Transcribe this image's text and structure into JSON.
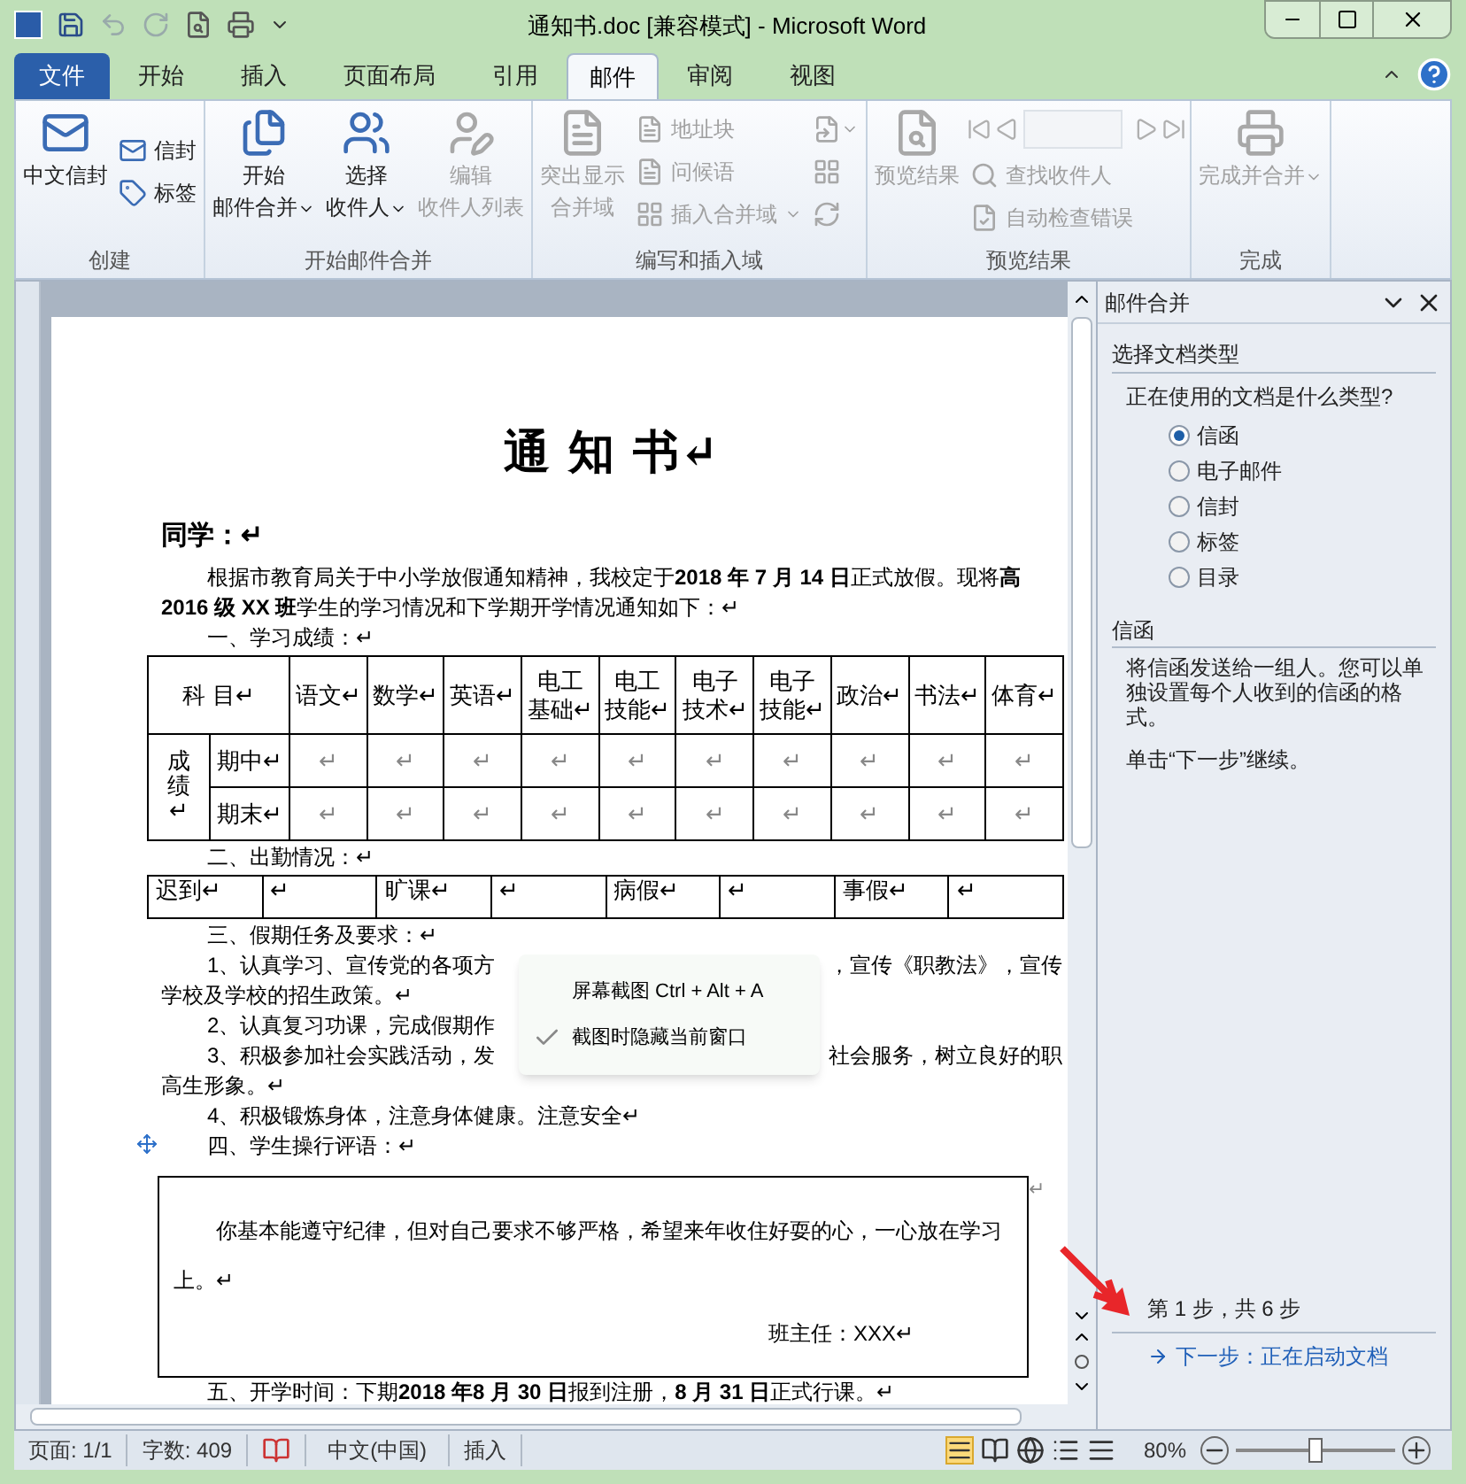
{
  "window": {
    "title": "通知书.doc [兼容模式] - Microsoft Word"
  },
  "tabs": [
    {
      "label": "文件",
      "kind": "file",
      "selected": false
    },
    {
      "label": "开始",
      "kind": "tab",
      "selected": false
    },
    {
      "label": "插入",
      "kind": "tab",
      "selected": false
    },
    {
      "label": "页面布局",
      "kind": "tab",
      "selected": false
    },
    {
      "label": "引用",
      "kind": "tab",
      "selected": false
    },
    {
      "label": "邮件",
      "kind": "tab",
      "selected": true
    },
    {
      "label": "审阅",
      "kind": "tab",
      "selected": false
    },
    {
      "label": "视图",
      "kind": "tab",
      "selected": false
    }
  ],
  "ribbon_groups": [
    {
      "title": "创建",
      "items": [
        {
          "kind": "large",
          "lines": [
            "中文信封"
          ],
          "disabled": false,
          "dropdown": false
        },
        {
          "kind": "small",
          "label": "信封",
          "disabled": false,
          "dropdown": false
        },
        {
          "kind": "small",
          "label": "标签",
          "disabled": false,
          "dropdown": false
        }
      ]
    },
    {
      "title": "开始邮件合并",
      "items": [
        {
          "kind": "large",
          "lines": [
            "开始",
            "邮件合并"
          ],
          "disabled": false,
          "dropdown": true
        },
        {
          "kind": "large",
          "lines": [
            "选择",
            "收件人"
          ],
          "disabled": false,
          "dropdown": true
        },
        {
          "kind": "large",
          "lines": [
            "编辑",
            "收件人列表"
          ],
          "disabled": true,
          "dropdown": false
        }
      ]
    },
    {
      "title": "编写和插入域",
      "items": [
        {
          "kind": "large",
          "lines": [
            "突出显示",
            "合并域"
          ],
          "disabled": true,
          "dropdown": false
        },
        {
          "kind": "small",
          "label": "地址块",
          "disabled": true,
          "dropdown": false
        },
        {
          "kind": "small",
          "label": "问候语",
          "disabled": true,
          "dropdown": false
        },
        {
          "kind": "small",
          "label": "插入合并域",
          "disabled": true,
          "dropdown": true
        },
        {
          "kind": "icon",
          "disabled": true,
          "dropdown": true
        },
        {
          "kind": "icon",
          "disabled": true,
          "dropdown": false
        },
        {
          "kind": "icon",
          "disabled": true,
          "dropdown": false
        }
      ]
    },
    {
      "title": "预览结果",
      "items": [
        {
          "kind": "large",
          "lines": [
            "预览结果"
          ],
          "disabled": true,
          "dropdown": false
        },
        {
          "kind": "nav",
          "disabled": true
        },
        {
          "kind": "small",
          "label": "查找收件人",
          "disabled": true,
          "dropdown": false
        },
        {
          "kind": "small",
          "label": "自动检查错误",
          "disabled": true,
          "dropdown": false
        }
      ]
    },
    {
      "title": "完成",
      "items": [
        {
          "kind": "large",
          "lines": [
            "完成并合并"
          ],
          "disabled": true,
          "dropdown": true
        }
      ]
    }
  ],
  "document": [
    {
      "kind": "title",
      "text": "通 知 书↵"
    },
    {
      "kind": "greeting",
      "text": "同学：↵"
    },
    {
      "kind": "line",
      "text": "根据市教育局关于中小学放假通知精神，我校定于**2018 年 7 月 14 日**正式放假。现将**高**"
    },
    {
      "kind": "continuation",
      "text": "**2016 级 XX 班**学生的学习情况和下学期开学情况通知如下：↵"
    },
    {
      "kind": "line",
      "text": "一、学习成绩：↵"
    },
    {
      "kind": "score_table",
      "header": "科 目↵",
      "columns": [
        {
          "lines": [
            "语文↵"
          ]
        },
        {
          "lines": [
            "数学↵"
          ]
        },
        {
          "lines": [
            "英语↵"
          ]
        },
        {
          "lines": [
            "电工",
            "基础↵"
          ]
        },
        {
          "lines": [
            "电工",
            "技能↵"
          ]
        },
        {
          "lines": [
            "电子",
            "技术↵"
          ]
        },
        {
          "lines": [
            "电子",
            "技能↵"
          ]
        },
        {
          "lines": [
            "政治↵"
          ]
        },
        {
          "lines": [
            "书法↵"
          ]
        },
        {
          "lines": [
            "体育↵"
          ]
        }
      ],
      "group_label": "成绩↵",
      "rows": [
        {
          "label": "期中↵",
          "cells": [
            "↵",
            "↵",
            "↵",
            "↵",
            "↵",
            "↵",
            "↵",
            "↵",
            "↵",
            "↵"
          ]
        },
        {
          "label": "期末↵",
          "cells": [
            "↵",
            "↵",
            "↵",
            "↵",
            "↵",
            "↵",
            "↵",
            "↵",
            "↵",
            "↵"
          ]
        }
      ]
    },
    {
      "kind": "line",
      "text": "二、出勤情况：↵"
    },
    {
      "kind": "attendance_table",
      "cells": [
        "迟到↵",
        "↵",
        "旷课↵",
        "↵",
        "病假↵",
        "↵",
        "事假↵",
        "↵"
      ]
    },
    {
      "kind": "line",
      "text": "三、假期任务及要求：↵"
    },
    {
      "kind": "covered_line",
      "segments": [
        "1、认真学习、宣传党的各项方",
        "，宣传《职教法》，宣传"
      ]
    },
    {
      "kind": "continuation",
      "text": "学校及学校的招生政策。↵"
    },
    {
      "kind": "line",
      "text": "2、认真复习功课，完成假期作"
    },
    {
      "kind": "covered_line",
      "segments": [
        "3、积极参加社会实践活动，发",
        "社会服务，树立良好的职"
      ]
    },
    {
      "kind": "continuation",
      "text": "高生形象。↵"
    },
    {
      "kind": "line",
      "text": "4、积极锻炼身体，注意身体健康。注意安全↵"
    },
    {
      "kind": "line",
      "text": "四、学生操行评语：↵"
    },
    {
      "kind": "comment_box",
      "text": "你基本能遵守纪律，但对自己要求不够严格，希望来年收住好耍的心，一心放在学习上。↵",
      "signature": "班主任：XXX↵",
      "outside_mark": "↵"
    },
    {
      "kind": "line",
      "text": "五、开学时间：下期**2018 年8 月 30 日**报到注册，**8 月 31 日**正式行课。↵"
    }
  ],
  "context_menu": [
    {
      "label": "屏幕截图 Ctrl + Alt + A",
      "checked": false
    },
    {
      "label": "截图时隐藏当前窗口",
      "checked": true
    }
  ],
  "task_pane": {
    "title": "邮件合并",
    "section_title": "选择文档类型",
    "question": "正在使用的文档是什么类型?",
    "options": [
      {
        "label": "信函",
        "selected": true
      },
      {
        "label": "电子邮件",
        "selected": false
      },
      {
        "label": "信封",
        "selected": false
      },
      {
        "label": "标签",
        "selected": false
      },
      {
        "label": "目录",
        "selected": false
      }
    ],
    "detail_title": "信函",
    "description": "将信函发送给一组人。您可以单独设置每个人收到的信函的格式。",
    "hint": "单击“下一步”继续。",
    "step": "第 1 步，共 6 步",
    "next_link": "下一步：正在启动文档"
  },
  "status_bar": {
    "items": [
      "页面: 1/1",
      "字数: 409"
    ],
    "language": "中文(中国)",
    "mode": "插入",
    "zoom": "80%",
    "zoom_level": {
      "level": 0.5
    }
  }
}
